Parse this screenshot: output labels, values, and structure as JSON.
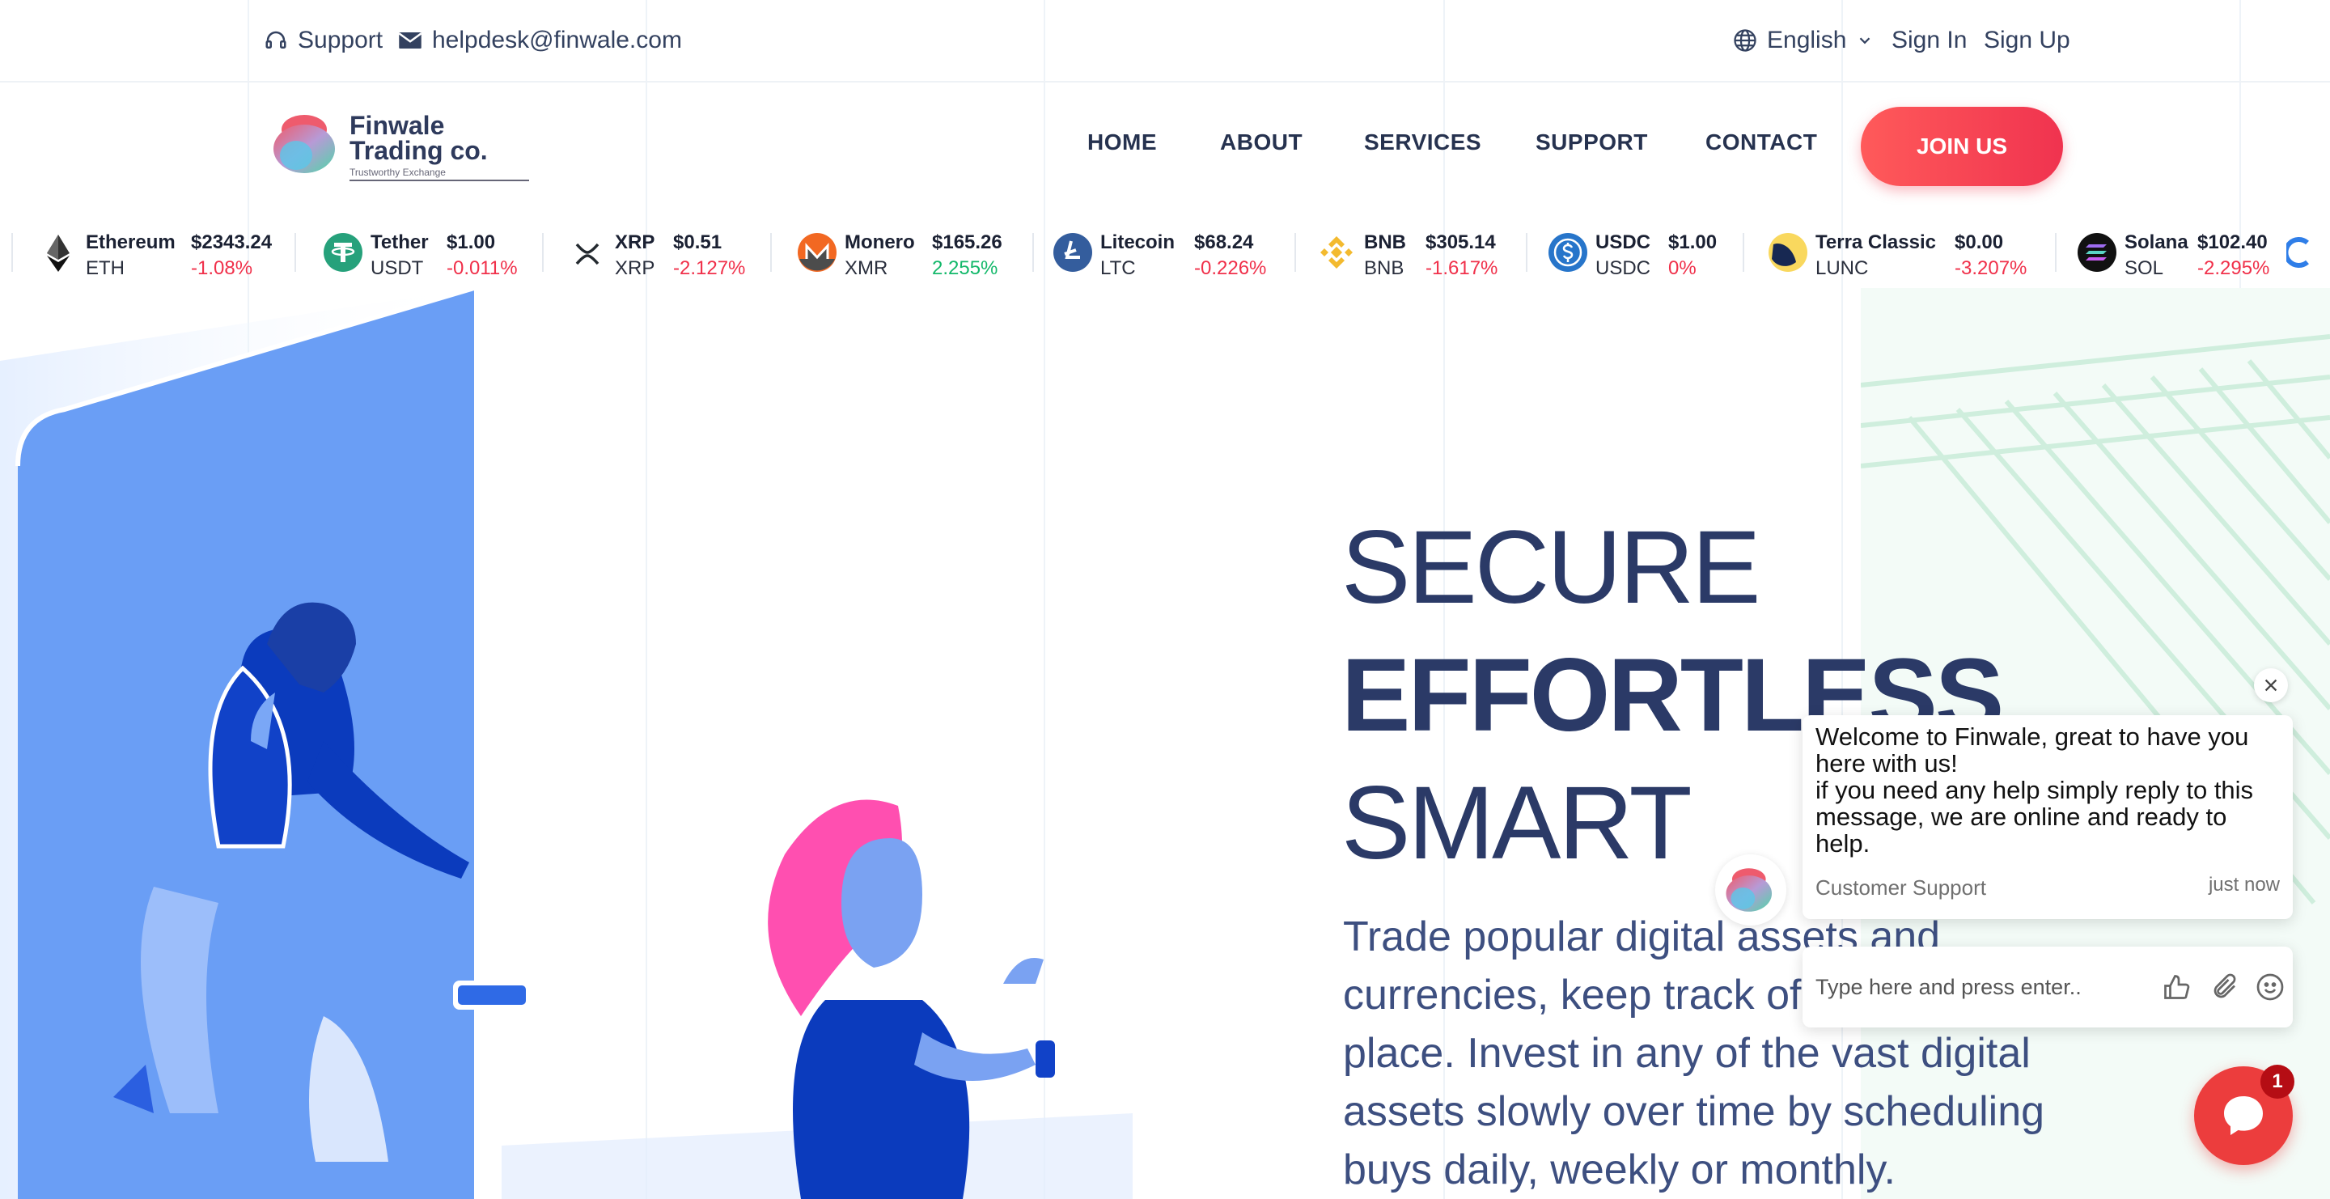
{
  "topbar": {
    "support_label": "Support",
    "email": "helpdesk@finwale.com",
    "language": "English",
    "sign_in": "Sign In",
    "sign_up": "Sign Up"
  },
  "brand": {
    "name_line1": "Finwale",
    "name_line2": "Trading co.",
    "tagline": "Trustworthy Exchange"
  },
  "nav": {
    "home": "HOME",
    "about": "ABOUT",
    "services": "SERVICES",
    "support": "SUPPORT",
    "contact": "CONTACT",
    "join": "JOIN US"
  },
  "ticker": [
    {
      "name": "Ethereum",
      "symbol": "ETH",
      "price": "$2343.24",
      "change": "-1.08%",
      "direction": "down",
      "icon": "ethereum-icon",
      "color": "#222222"
    },
    {
      "name": "Tether",
      "symbol": "USDT",
      "price": "$1.00",
      "change": "-0.011%",
      "direction": "down",
      "icon": "tether-icon",
      "color": "#26a17b"
    },
    {
      "name": "XRP",
      "symbol": "XRP",
      "price": "$0.51",
      "change": "-2.127%",
      "direction": "down",
      "icon": "xrp-icon",
      "color": "#23292f"
    },
    {
      "name": "Monero",
      "symbol": "XMR",
      "price": "$165.26",
      "change": "2.255%",
      "direction": "up",
      "icon": "monero-icon",
      "color": "#f26822"
    },
    {
      "name": "Litecoin",
      "symbol": "LTC",
      "price": "$68.24",
      "change": "-0.226%",
      "direction": "down",
      "icon": "litecoin-icon",
      "color": "#345d9d"
    },
    {
      "name": "BNB",
      "symbol": "BNB",
      "price": "$305.14",
      "change": "-1.617%",
      "direction": "down",
      "icon": "bnb-icon",
      "color": "#f3ba2f"
    },
    {
      "name": "USDC",
      "symbol": "USDC",
      "price": "$1.00",
      "change": "0%",
      "direction": "down",
      "icon": "usdc-icon",
      "color": "#2775ca"
    },
    {
      "name": "Terra Classic",
      "symbol": "LUNC",
      "price": "$0.00",
      "change": "-3.207%",
      "direction": "down",
      "icon": "terra-classic-icon",
      "color": "#f9d85e"
    },
    {
      "name": "Solana",
      "symbol": "SOL",
      "price": "$102.40",
      "change": "-2.295%",
      "direction": "down",
      "icon": "solana-icon",
      "color": "#1d1d1d"
    }
  ],
  "hero": {
    "line1": "SECURE",
    "line2": "EFFORTLESS",
    "line3": "SMART",
    "description": "Trade popular digital assets and currencies, keep track of them in one place. Invest in any of the vast digital assets slowly over time by scheduling buys daily, weekly or monthly."
  },
  "chat": {
    "message": "Welcome to Finwale, great to have you here with us!\nif you need any help simply reply to this message, we are online and ready to help.",
    "sender": "Customer Support",
    "time": "just now",
    "input_placeholder": "Type here and press enter..",
    "badge_count": "1"
  },
  "colors": {
    "accent": "#f0334f",
    "nav_text": "#26324f",
    "hero_text": "#2b3a67",
    "illustration_blue": "#6a9ef5",
    "negative": "#f0304a",
    "positive": "#13b86a"
  }
}
